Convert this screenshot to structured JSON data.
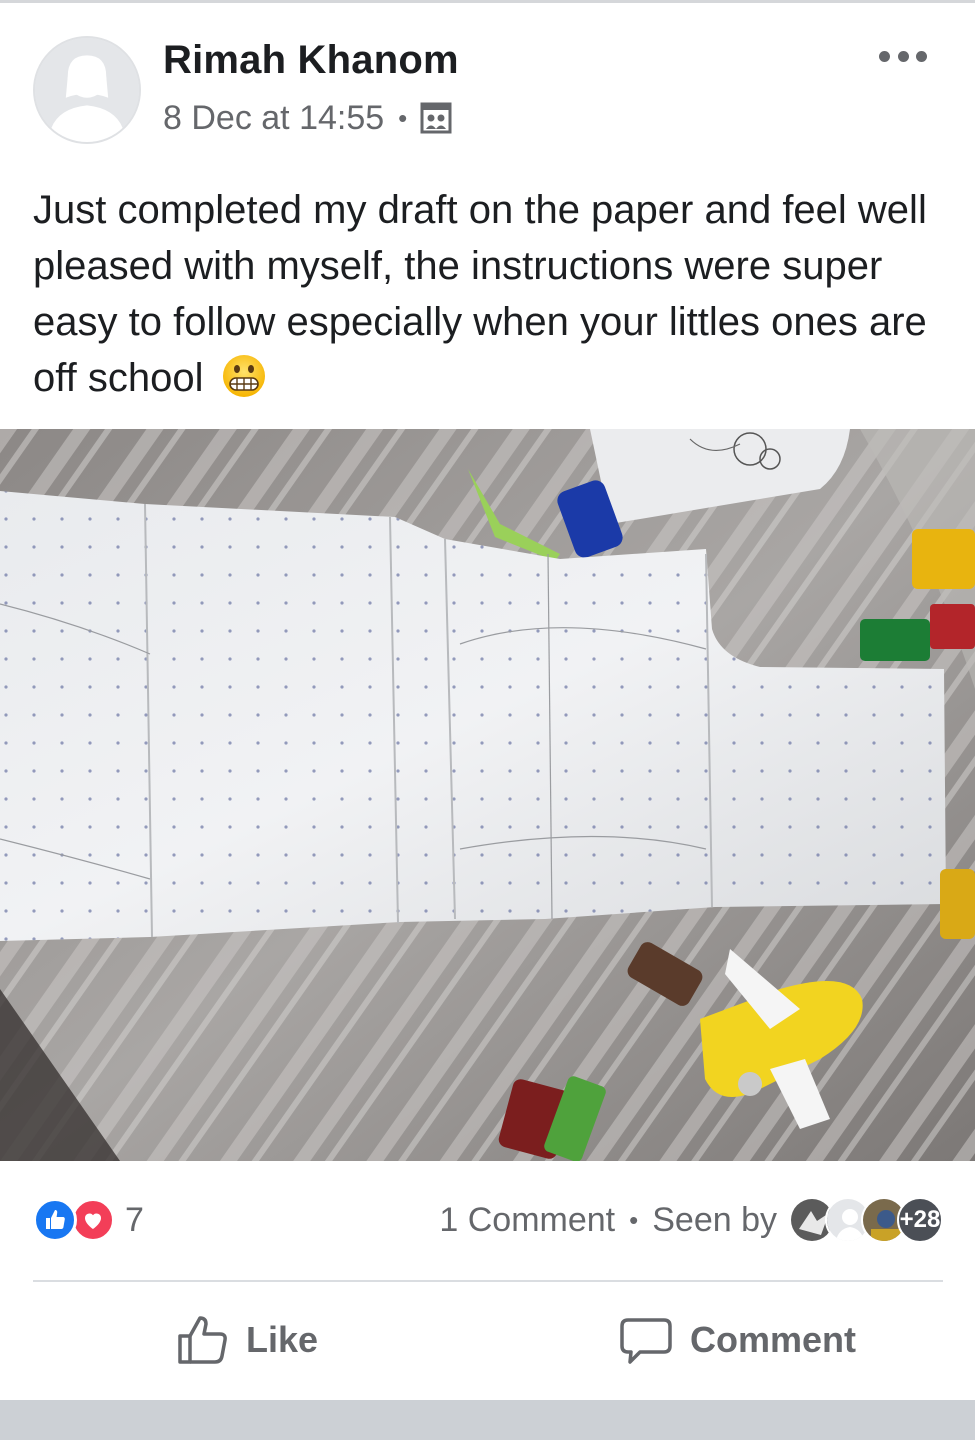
{
  "post": {
    "author": "Rimah Khanom",
    "timestamp": "8 Dec at 14:55",
    "meta_separator": "•",
    "audience_icon": "photo-audience-icon",
    "text": "Just completed my draft on the paper and feel well pleased with myself, the instructions were super easy to follow especially when your littles ones are off school",
    "emoji": "grimacing-face-emoji"
  },
  "reactions": {
    "types": [
      "like",
      "love"
    ],
    "count": "7"
  },
  "engagement": {
    "comments": "1 Comment",
    "separator": "•",
    "seen_label": "Seen by",
    "seen_more": "+28"
  },
  "actions": {
    "like_label": "Like",
    "comment_label": "Comment"
  },
  "colors": {
    "like_blue": "#1877f2",
    "love_red": "#f33e58",
    "secondary_text": "#65676b",
    "primary_text": "#1c1e21"
  }
}
